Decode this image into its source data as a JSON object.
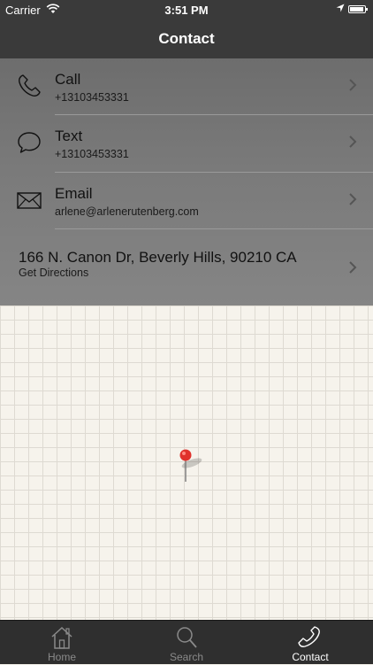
{
  "status_bar": {
    "carrier": "Carrier",
    "time": "3:51 PM"
  },
  "nav": {
    "title": "Contact"
  },
  "contact": {
    "rows": [
      {
        "label": "Call",
        "sub": "+13103453331",
        "icon": "phone-icon"
      },
      {
        "label": "Text",
        "sub": "+13103453331",
        "icon": "chat-bubble-icon"
      },
      {
        "label": "Email",
        "sub": "arlene@arlenerutenberg.com",
        "icon": "envelope-icon"
      }
    ],
    "address": {
      "label": "166 N. Canon Dr, Beverly Hills, 90210 CA",
      "sub": "Get Directions"
    }
  },
  "tabs": [
    {
      "label": "Home",
      "icon": "house-icon",
      "active": false
    },
    {
      "label": "Search",
      "icon": "magnifier-icon",
      "active": false
    },
    {
      "label": "Contact",
      "icon": "phone-icon",
      "active": true
    }
  ],
  "colors": {
    "bar": "#3a3a3a",
    "panel": "#7a7a7a",
    "pin": "#e0312b",
    "tab_active": "#ffffff",
    "tab_inactive": "#8a8a8a"
  }
}
